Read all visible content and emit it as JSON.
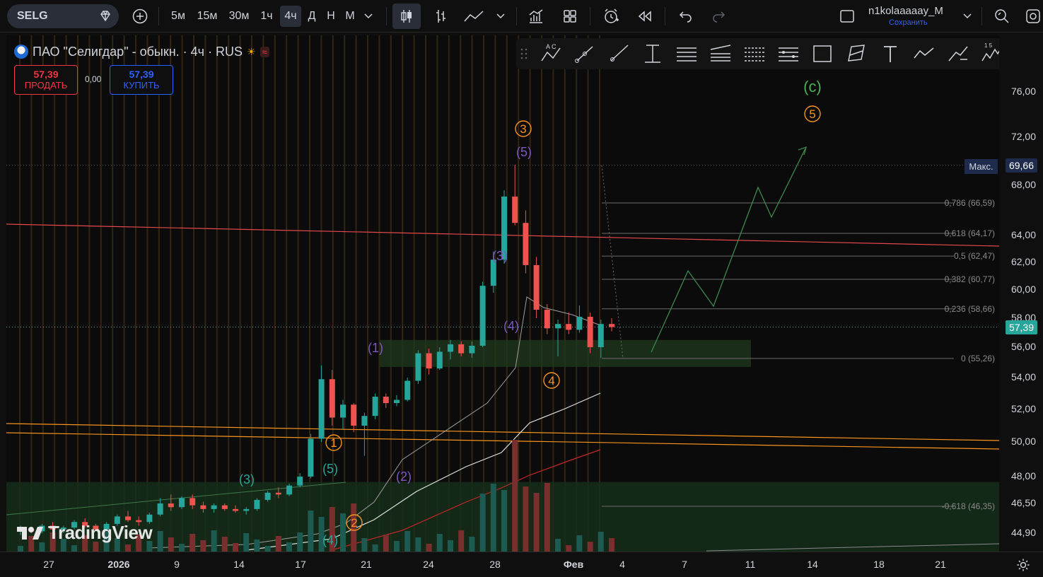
{
  "toolbar": {
    "symbol": "SELG",
    "intervals": [
      "5м",
      "15м",
      "30м",
      "1ч",
      "4ч",
      "Д",
      "Н",
      "М"
    ],
    "active_interval": "4ч",
    "user": "n1kolaaaaay_M",
    "save_label": "Сохранить"
  },
  "legend": {
    "title": "ПАО \"Селигдар\" - обыкн. · 4ч · RUS",
    "sell_price": "57,39",
    "sell_label": "ПРОДАТЬ",
    "spread": "0,00",
    "buy_price": "57,39",
    "buy_label": "КУПИТЬ"
  },
  "price_axis": {
    "labels": [
      "76,00",
      "72,00",
      "68,00",
      "64,00",
      "62,00",
      "60,00",
      "58,00",
      "56,00",
      "54,00",
      "52,00",
      "50,00",
      "48,00",
      "46,50",
      "44,90"
    ],
    "max_label": "Макс.",
    "max_value": "69,66",
    "last_price": "57,39"
  },
  "time_axis": {
    "labels": [
      "27",
      "2026",
      "9",
      "14",
      "17",
      "21",
      "24",
      "28",
      "Фев",
      "4",
      "7",
      "11",
      "14",
      "18",
      "21"
    ]
  },
  "fib_levels": [
    {
      "label": "0,786 (66,59)",
      "price": 66.59
    },
    {
      "label": "0,618 (64,17)",
      "price": 64.17
    },
    {
      "label": "0,5 (62,47)",
      "price": 62.47
    },
    {
      "label": "0,382 (60,77)",
      "price": 60.77
    },
    {
      "label": "0,236 (58,66)",
      "price": 58.66
    },
    {
      "label": "0 (55,26)",
      "price": 55.26
    },
    {
      "label": "-0,618 (46,35)",
      "price": 46.35
    }
  ],
  "wave_labels": {
    "orange": [
      "1",
      "2",
      "3",
      "4",
      "5"
    ],
    "purple": [
      "(1)",
      "(2)",
      "(3)",
      "(4)",
      "(5)"
    ],
    "teal": [
      "(3)",
      "(4)",
      "(5)"
    ],
    "green": "(c)"
  },
  "watermark": "TradingView",
  "colors": {
    "up": "#26a69a",
    "down": "#ef5350",
    "orange_wave": "#f7931e",
    "purple_wave": "#7e57c2",
    "teal_wave": "#26a69a",
    "green_wave": "#4caf50",
    "accent": "#2962ff"
  },
  "chart_data": {
    "type": "candlestick",
    "symbol": "SELG",
    "interval": "4ч",
    "ylim": [
      44.0,
      77.5
    ],
    "last_price": 57.39,
    "max_price": 69.66,
    "candles": [
      [
        45.0,
        45.3,
        44.8,
        45.1
      ],
      [
        45.1,
        45.2,
        44.9,
        45.0
      ],
      [
        45.0,
        45.4,
        44.9,
        45.3
      ],
      [
        45.3,
        45.5,
        45.0,
        45.1
      ],
      [
        45.1,
        45.3,
        44.9,
        45.2
      ],
      [
        45.2,
        45.6,
        45.1,
        45.5
      ],
      [
        45.5,
        45.7,
        45.2,
        45.3
      ],
      [
        45.3,
        45.4,
        45.0,
        45.1
      ],
      [
        45.1,
        45.5,
        45.0,
        45.4
      ],
      [
        45.4,
        45.9,
        45.3,
        45.8
      ],
      [
        45.8,
        46.1,
        45.5,
        45.6
      ],
      [
        45.6,
        45.8,
        45.3,
        45.5
      ],
      [
        45.5,
        46.0,
        45.4,
        45.9
      ],
      [
        45.9,
        46.8,
        45.8,
        46.5
      ],
      [
        46.5,
        47.0,
        46.1,
        46.3
      ],
      [
        46.3,
        46.9,
        46.2,
        46.8
      ],
      [
        46.8,
        47.0,
        46.2,
        46.4
      ],
      [
        46.4,
        46.6,
        46.0,
        46.2
      ],
      [
        46.2,
        46.5,
        46.0,
        46.4
      ],
      [
        46.4,
        46.5,
        46.1,
        46.2
      ],
      [
        46.2,
        46.4,
        46.0,
        46.1
      ],
      [
        46.1,
        46.3,
        45.9,
        46.2
      ],
      [
        46.2,
        46.8,
        46.1,
        46.7
      ],
      [
        46.7,
        47.2,
        46.6,
        47.1
      ],
      [
        47.1,
        47.4,
        46.8,
        47.0
      ],
      [
        47.0,
        47.6,
        46.9,
        47.5
      ],
      [
        47.5,
        48.2,
        47.4,
        48.0
      ],
      [
        48.0,
        50.5,
        47.9,
        50.2
      ],
      [
        50.2,
        54.8,
        50.0,
        53.9
      ],
      [
        53.9,
        54.5,
        51.0,
        51.5
      ],
      [
        51.5,
        52.6,
        50.8,
        52.3
      ],
      [
        52.3,
        52.4,
        50.6,
        51.0
      ],
      [
        51.0,
        51.8,
        49.2,
        51.6
      ],
      [
        51.6,
        53.0,
        51.4,
        52.8
      ],
      [
        52.8,
        53.0,
        52.1,
        52.4
      ],
      [
        52.4,
        52.9,
        52.2,
        52.6
      ],
      [
        52.6,
        54.0,
        52.5,
        53.8
      ],
      [
        53.8,
        55.8,
        53.6,
        55.6
      ],
      [
        55.6,
        55.9,
        54.2,
        54.6
      ],
      [
        54.6,
        56.0,
        54.5,
        55.7
      ],
      [
        55.7,
        56.5,
        55.2,
        56.2
      ],
      [
        56.2,
        56.4,
        55.4,
        55.6
      ],
      [
        55.6,
        56.4,
        55.3,
        56.1
      ],
      [
        56.1,
        60.6,
        56.0,
        60.3
      ],
      [
        60.3,
        62.8,
        59.8,
        62.2
      ],
      [
        62.2,
        67.6,
        61.9,
        67.1
      ],
      [
        67.1,
        69.7,
        64.8,
        65.0
      ],
      [
        65.0,
        66.0,
        61.2,
        61.8
      ],
      [
        61.8,
        62.4,
        58.0,
        58.6
      ],
      [
        58.6,
        59.0,
        56.9,
        57.3
      ],
      [
        57.3,
        57.9,
        55.4,
        57.6
      ],
      [
        57.6,
        58.4,
        56.9,
        57.2
      ],
      [
        57.2,
        58.9,
        57.0,
        58.1
      ],
      [
        58.1,
        58.4,
        55.6,
        56.0
      ],
      [
        56.0,
        57.9,
        55.3,
        57.6
      ],
      [
        57.6,
        58.0,
        57.1,
        57.39
      ]
    ],
    "up_color": "#26a69a",
    "down_color": "#ef5350",
    "price_ticks": [
      76.0,
      72.0,
      68.0,
      64.0,
      62.0,
      60.0,
      58.0,
      56.0,
      54.0,
      52.0,
      50.0,
      48.0,
      46.5,
      44.9
    ],
    "x_ticks": [
      "27",
      "2026",
      "9",
      "14",
      "17",
      "21",
      "24",
      "28",
      "Фев",
      "4",
      "7",
      "11",
      "14",
      "18",
      "21"
    ]
  }
}
